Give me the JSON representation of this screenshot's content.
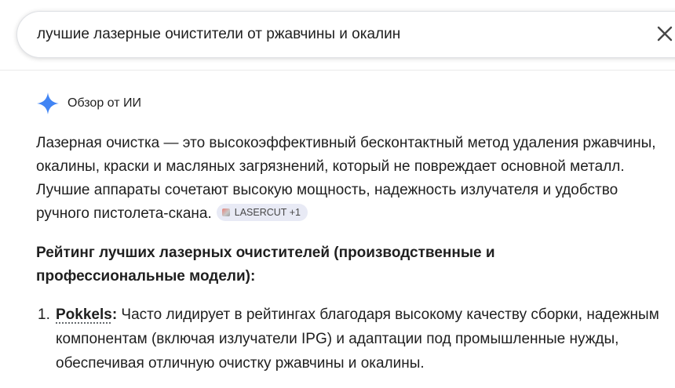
{
  "search": {
    "query": "лучшие лазерные очистители от ржавчины и окалин"
  },
  "ai_overview": {
    "label": "Обзор от ИИ",
    "accent_color": "#4285f4",
    "summary": "Лазерная очистка — это высокоэффективный бесконтактный метод удаления ржавчины, окалины, краски и масляных загрязнений, который не повреждает основной металл. Лучшие аппараты сочетают высокую мощность, надежность излучателя и удобство ручного пистолета-скана.",
    "source_chip": "LASERCUT +1",
    "section_heading": "Рейтинг лучших лазерных очистителей (производственные и профессиональные модели):",
    "list": [
      {
        "number": "1.",
        "brand": "Pokkels",
        "colon": ":",
        "text": " Часто лидирует в рейтингах благодаря высокому качеству сборки, надежным компонентам (включая излучатели IPG) и адаптации под промышленные нужды, обеспечивая отличную очистку ржавчины и окалины."
      }
    ]
  }
}
